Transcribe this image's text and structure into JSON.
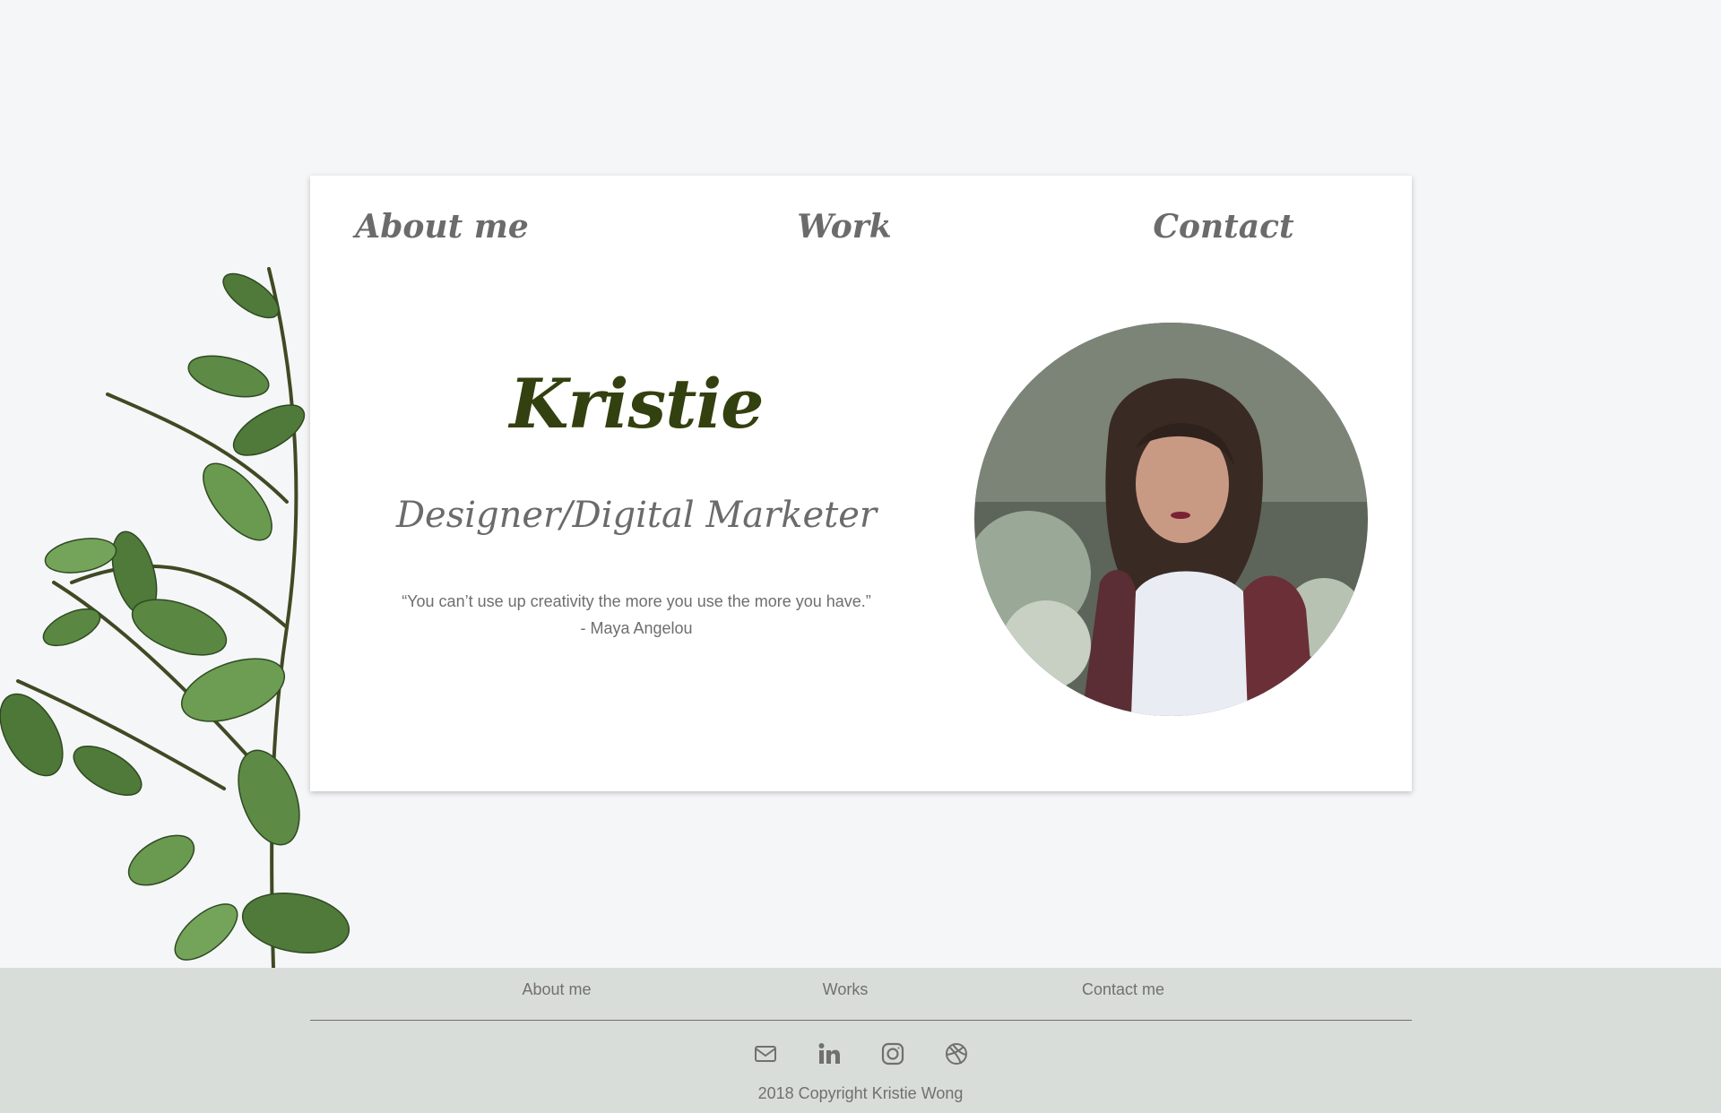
{
  "nav": {
    "about": "About me",
    "work": "Work",
    "contact": "Contact"
  },
  "hero": {
    "name": "Kristie",
    "role": "Designer/Digital Marketer",
    "quote_line1": "“You can’t use up creativity the more you use the more you have.”",
    "quote_line2": "- Maya Angelou"
  },
  "footer": {
    "links": {
      "about": "About me",
      "works": "Works",
      "contact": "Contact me"
    },
    "social_icons": [
      "mail-icon",
      "linkedin-icon",
      "instagram-icon",
      "dribbble-icon"
    ],
    "copyright": "2018 Copyright Kristie Wong"
  },
  "colors": {
    "page_bg": "#f5f6f7",
    "card_bg": "#ffffff",
    "name_color": "#33400f",
    "text_gray": "#6b6b6b",
    "footer_bg": "#d9ddd9"
  }
}
